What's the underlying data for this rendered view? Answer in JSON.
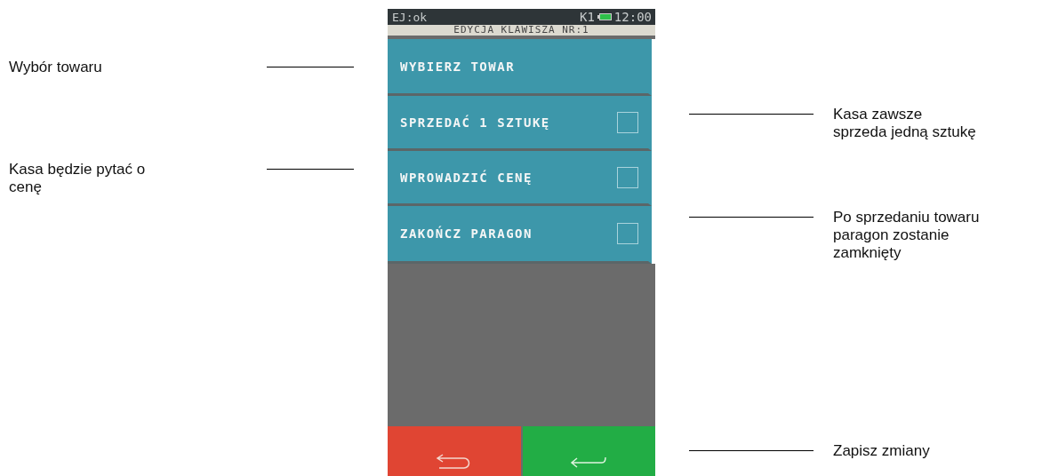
{
  "status_bar": {
    "journal": "EJ:ok",
    "register": "K1",
    "time": "12:00"
  },
  "header": {
    "title": "EDYCJA KLAWISZA NR:1"
  },
  "items": [
    {
      "kind": "action",
      "label": "WYBIERZ TOWAR",
      "note_left": [
        "Wybór towaru"
      ]
    },
    {
      "kind": "checkbox",
      "label": "SPRZEDAĆ 1 SZTUKĘ",
      "checked": false,
      "note_right": [
        "Kasa zawsze",
        "sprzeda jedną sztukę"
      ]
    },
    {
      "kind": "checkbox",
      "label": "WPROWADZIĆ CENĘ",
      "checked": false,
      "note_left": [
        "Kasa będzie pytać o",
        "cenę"
      ]
    },
    {
      "kind": "checkbox",
      "label": "ZAKOŃCZ PARAGON",
      "checked": false,
      "note_right": [
        "Po sprzedaniu towaru",
        "paragon zostanie",
        "zamknięty"
      ]
    }
  ],
  "buttons": [
    {
      "kind": "back"
    },
    {
      "kind": "confirm"
    }
  ],
  "buttons_note": [
    "Zapisz zmiany"
  ]
}
